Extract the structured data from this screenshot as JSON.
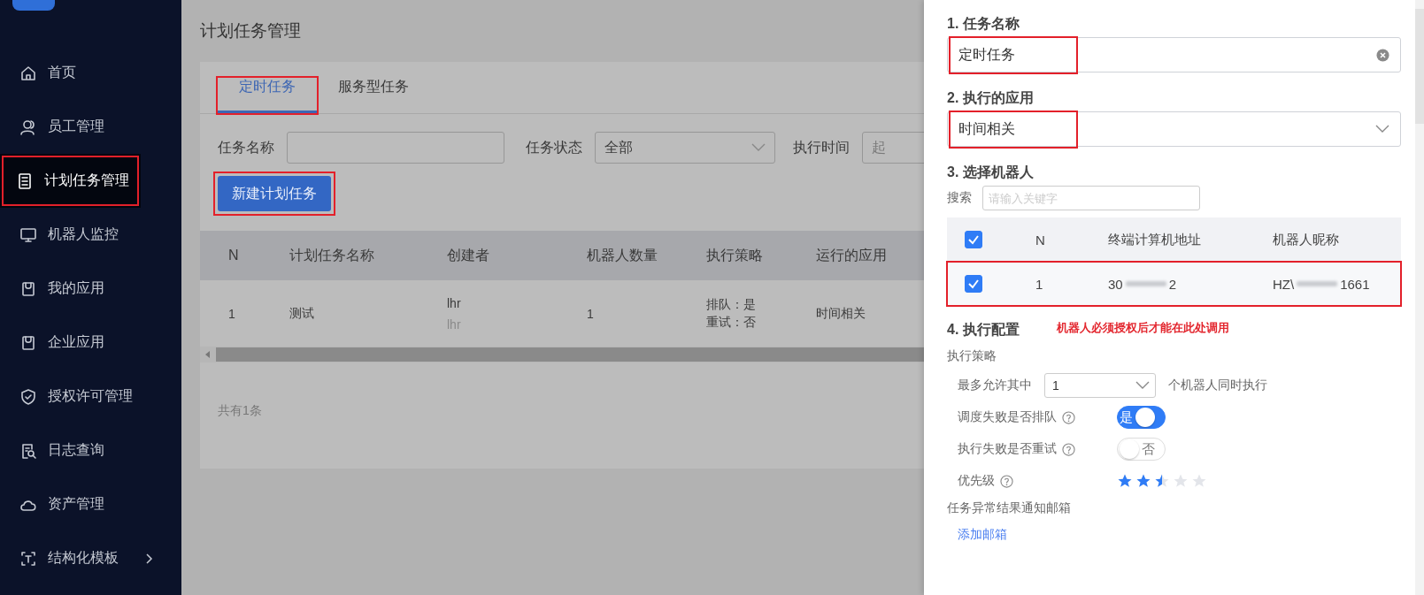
{
  "sidebar": {
    "items": [
      {
        "label": "首页",
        "selected": false,
        "highlighted": false
      },
      {
        "label": "员工管理",
        "selected": false,
        "highlighted": false
      },
      {
        "label": "计划任务管理",
        "selected": true,
        "highlighted": true
      },
      {
        "label": "机器人监控",
        "selected": false,
        "highlighted": false
      },
      {
        "label": "我的应用",
        "selected": false,
        "highlighted": false
      },
      {
        "label": "企业应用",
        "selected": false,
        "highlighted": false
      },
      {
        "label": "授权许可管理",
        "selected": false,
        "highlighted": false
      },
      {
        "label": "日志查询",
        "selected": false,
        "highlighted": false
      },
      {
        "label": "资产管理",
        "selected": false,
        "highlighted": false
      },
      {
        "label": "结构化模板",
        "selected": false,
        "highlighted": false,
        "expanded": false
      }
    ]
  },
  "page_title": "计划任务管理",
  "tabs": [
    {
      "label": "定时任务",
      "selected": true,
      "highlighted": true
    },
    {
      "label": "服务型任务",
      "selected": false,
      "highlighted": false
    }
  ],
  "filters": [
    {
      "kind": "text",
      "label": "任务名称"
    },
    {
      "kind": "select",
      "label": "任务状态",
      "value": "全部"
    },
    {
      "kind": "date",
      "label": "执行时间",
      "placeholder": "起"
    }
  ],
  "new_button": {
    "label": "新建计划任务",
    "highlighted": true
  },
  "table": {
    "columns": [
      "N",
      "计划任务名称",
      "创建者",
      "机器人数量",
      "执行策略",
      "运行的应用"
    ],
    "rows": [
      {
        "n": "1",
        "name": "测试",
        "creator": "lhr",
        "creator_sub": "lhr",
        "robots": "1",
        "strategy": [
          "排队：是",
          "重试：否"
        ],
        "app": "时间相关"
      }
    ]
  },
  "total": "共有1条",
  "drawer": {
    "name_section": {
      "title": "1. 任务名称",
      "value": "定时任务",
      "highlighted": true
    },
    "app_section": {
      "title": "2. 执行的应用",
      "value": "时间相关",
      "highlighted": true
    },
    "robot_section": {
      "title": "3. 选择机器人",
      "search_label": "搜索",
      "search_placeholder": "请输入关键字",
      "select_all_checked": true,
      "columns": [
        "N",
        "终端计算机地址",
        "机器人昵称"
      ],
      "rows": [
        {
          "checked": true,
          "highlighted": true,
          "n": "1",
          "address_start": "30",
          "address_end": "2",
          "nickname_start": "HZ\\",
          "nickname_end": "1661"
        }
      ]
    },
    "config_section": {
      "title": "4. 执行配置",
      "note": "机器人必须授权后才能在此处调用",
      "strategy_label": "执行策略",
      "max_prefix": "最多允许其中",
      "max_value": "1",
      "max_suffix": "个机器人同时执行",
      "switches": [
        {
          "label": "调度失败是否排队",
          "on": true,
          "text": "是"
        },
        {
          "label": "执行失败是否重试",
          "on": false,
          "text": "否"
        }
      ],
      "priority_label": "优先级",
      "stars": 2.5,
      "email_label": "任务异常结果通知邮箱",
      "add_email": "添加邮箱"
    }
  }
}
